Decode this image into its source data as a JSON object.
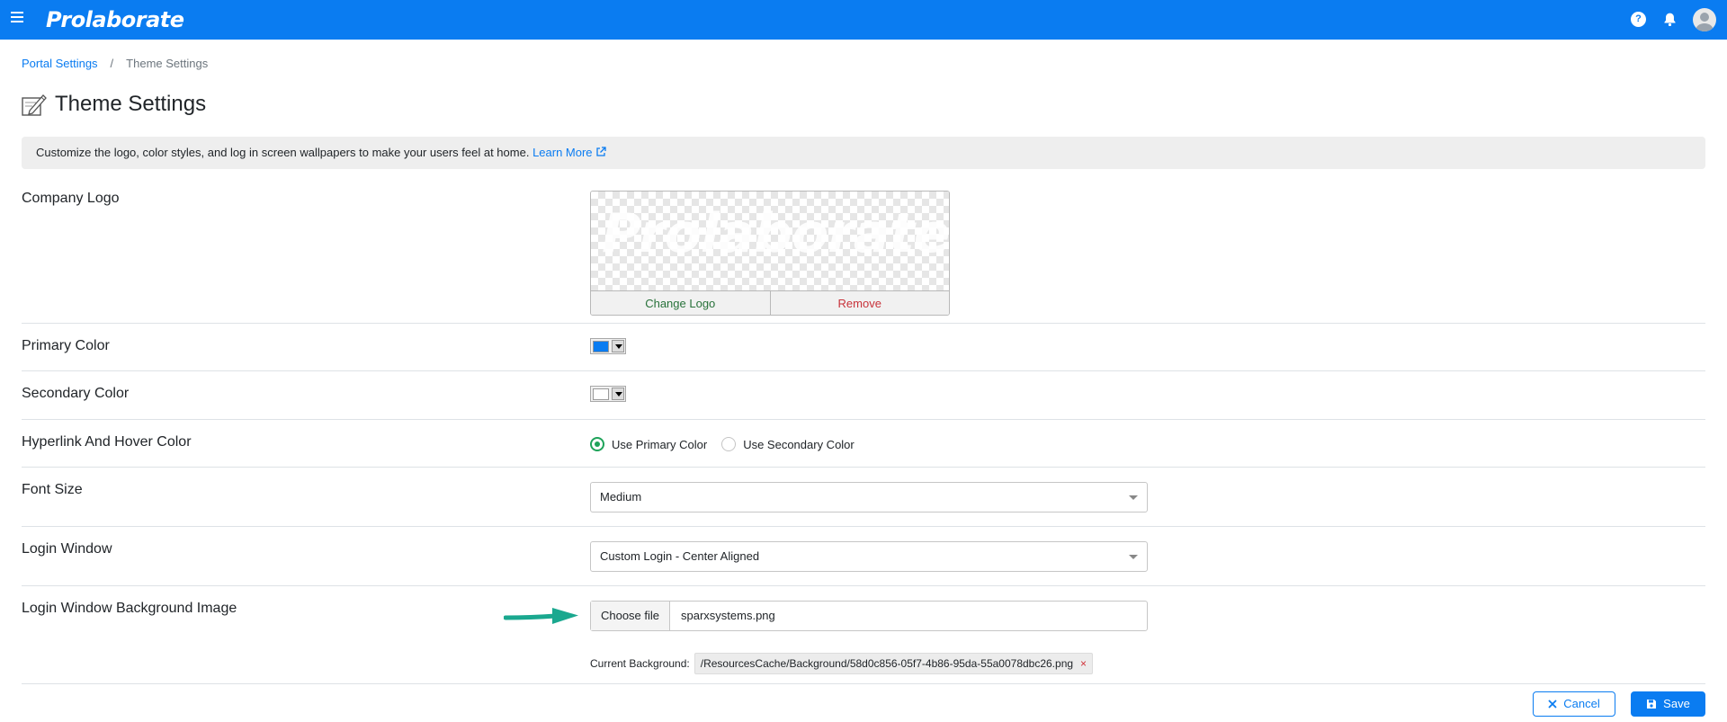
{
  "topbar": {
    "brand": "Prolaborate",
    "help_label": "?"
  },
  "breadcrumb": {
    "parent": "Portal Settings",
    "separator": "/",
    "current": "Theme Settings"
  },
  "page": {
    "title": "Theme Settings"
  },
  "info": {
    "text": "Customize the logo, color styles, and log in screen wallpapers to make your users feel at home. ",
    "link": "Learn More"
  },
  "settings": {
    "company_logo": {
      "label": "Company Logo",
      "preview_text": "Prolaborate",
      "change_label": "Change Logo",
      "remove_label": "Remove"
    },
    "primary_color": {
      "label": "Primary Color",
      "value": "#0a7cf1"
    },
    "secondary_color": {
      "label": "Secondary Color",
      "value": "#ffffff"
    },
    "hyperlink_color": {
      "label": "Hyperlink And Hover Color",
      "options": [
        {
          "label": "Use Primary Color",
          "checked": true
        },
        {
          "label": "Use Secondary Color",
          "checked": false
        }
      ]
    },
    "font_size": {
      "label": "Font Size",
      "value": "Medium"
    },
    "login_window": {
      "label": "Login Window",
      "value": "Custom Login - Center Aligned"
    },
    "login_background": {
      "label": "Login Window Background Image",
      "choose_label": "Choose file",
      "file_name": "sparxsystems.png",
      "current_label": "Current Background:",
      "current_path": "/ResourcesCache/Background/58d0c856-05f7-4b86-95da-55a0078dbc26.png",
      "remove_glyph": "×"
    }
  },
  "actions": {
    "cancel_label": "Cancel",
    "save_label": "Save"
  },
  "colors": {
    "brand_blue": "#0a7cf1",
    "radio_green": "#1fa35a",
    "arrow_teal": "#1aa88f",
    "remove_red": "#c8323a",
    "change_green": "#28723a"
  }
}
